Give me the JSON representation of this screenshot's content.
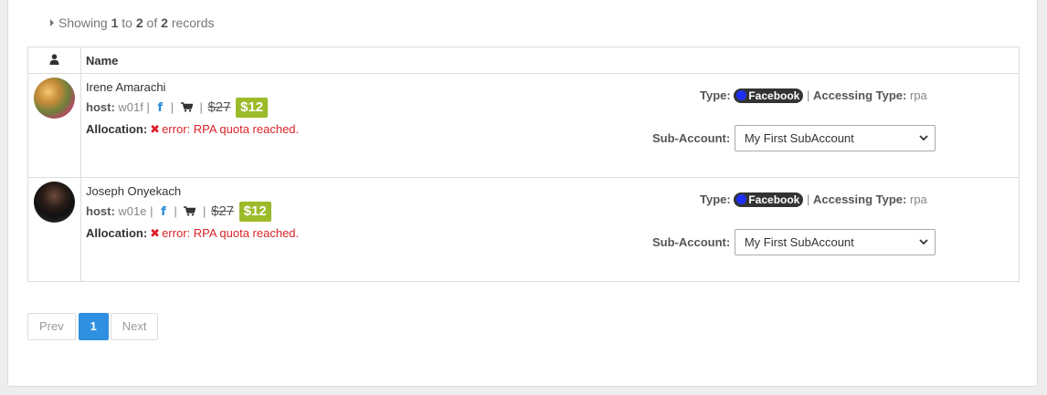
{
  "summary": {
    "prefix": "Showing",
    "from": "1",
    "to_word": "to",
    "to": "2",
    "of_word": "of",
    "total": "2",
    "suffix": "records"
  },
  "table": {
    "header_icon": "user-icon",
    "header_name": "Name"
  },
  "rows": [
    {
      "name": "Irene Amarachi",
      "host_label": "host:",
      "host": "w01f",
      "sep": "|",
      "old_price": "$27",
      "price": "$12",
      "alloc_label": "Allocation:",
      "error": "error: RPA quota reached.",
      "type_label": "Type:",
      "type_value": "Facebook",
      "accessing_label": "Accessing Type:",
      "accessing_value": "rpa",
      "subaccount_label": "Sub-Account:",
      "subaccount_value": "My First SubAccount"
    },
    {
      "name": "Joseph Onyekach",
      "host_label": "host:",
      "host": "w01e",
      "sep": "|",
      "old_price": "$27",
      "price": "$12",
      "alloc_label": "Allocation:",
      "error": "error: RPA quota reached.",
      "type_label": "Type:",
      "type_value": "Facebook",
      "accessing_label": "Accessing Type:",
      "accessing_value": "rpa",
      "subaccount_label": "Sub-Account:",
      "subaccount_value": "My First SubAccount"
    }
  ],
  "pagination": {
    "prev": "Prev",
    "current": "1",
    "next": "Next"
  },
  "colors": {
    "accent": "#2f8fe0",
    "price_badge": "#9bbb2a",
    "error": "#d9232b",
    "facebook": "#2a8ad4"
  },
  "icons": [
    "caret-right-icon",
    "user-icon",
    "facebook-icon",
    "cart-icon",
    "error-x-icon",
    "status-dot-icon",
    "chevron-down-icon"
  ]
}
